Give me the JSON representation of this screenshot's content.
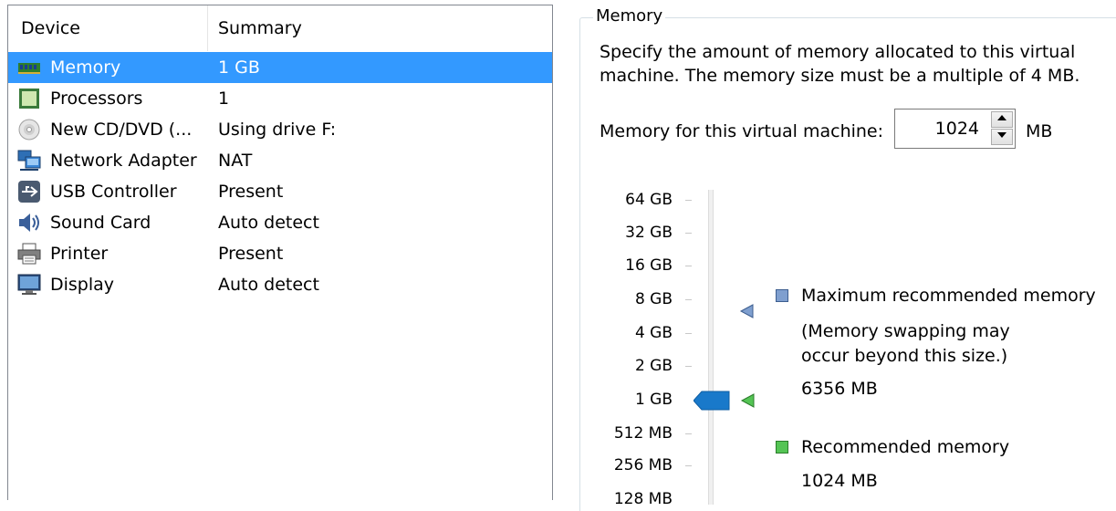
{
  "device_list": {
    "headers": {
      "device": "Device",
      "summary": "Summary"
    },
    "rows": [
      {
        "name": "Memory",
        "summary": "1 GB",
        "icon": "memory-icon",
        "selected": true
      },
      {
        "name": "Processors",
        "summary": "1",
        "icon": "processor-icon",
        "selected": false
      },
      {
        "name": "New CD/DVD (...",
        "summary": "Using drive F:",
        "icon": "cd-dvd-icon",
        "selected": false
      },
      {
        "name": "Network Adapter",
        "summary": "NAT",
        "icon": "network-adapter-icon",
        "selected": false
      },
      {
        "name": "USB Controller",
        "summary": "Present",
        "icon": "usb-icon",
        "selected": false
      },
      {
        "name": "Sound Card",
        "summary": "Auto detect",
        "icon": "speaker-icon",
        "selected": false
      },
      {
        "name": "Printer",
        "summary": "Present",
        "icon": "printer-icon",
        "selected": false
      },
      {
        "name": "Display",
        "summary": "Auto detect",
        "icon": "display-icon",
        "selected": false
      }
    ]
  },
  "memory_panel": {
    "group_title": "Memory",
    "description": "Specify the amount of memory allocated to this virtual machine. The memory size must be a multiple of 4 MB.",
    "field_label": "Memory for this virtual machine:",
    "field_value": "1024",
    "unit": "MB",
    "scale_labels": [
      "64 GB",
      "32 GB",
      "16 GB",
      "8 GB",
      "4 GB",
      "2 GB",
      "1 GB",
      "512 MB",
      "256 MB",
      "128 MB"
    ],
    "current_value_label": "1 GB",
    "max_recommended": {
      "title": "Maximum recommended memory",
      "note_line1": "(Memory swapping may",
      "note_line2": "occur beyond this size.)",
      "value": "6356 MB",
      "color": "#7f9fcf"
    },
    "recommended": {
      "title": "Recommended memory",
      "value": "1024 MB",
      "color": "#54c454"
    }
  },
  "colors": {
    "selection": "#3399ff",
    "thumb": "#1979ca"
  }
}
